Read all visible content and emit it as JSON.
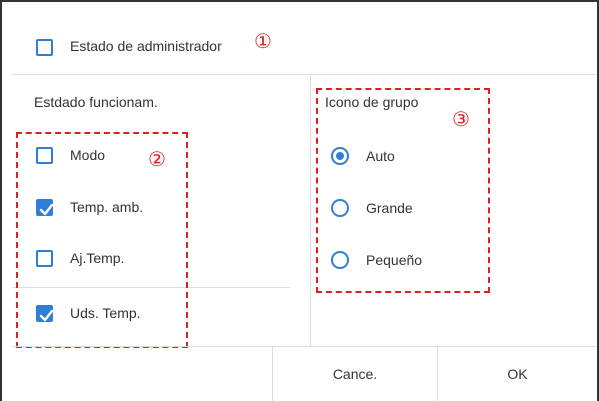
{
  "admin": {
    "label": "Estado de administrador",
    "checked": false
  },
  "status_section": {
    "title": "Estdado funcionam.",
    "items": [
      {
        "label": "Modo",
        "checked": false
      },
      {
        "label": "Temp. amb.",
        "checked": true
      },
      {
        "label": "Aj.Temp.",
        "checked": false
      },
      {
        "label": "Uds. Temp.",
        "checked": true
      }
    ]
  },
  "group_icon": {
    "title": "Icono de grupo",
    "options": [
      {
        "label": "Auto",
        "selected": true
      },
      {
        "label": "Grande",
        "selected": false
      },
      {
        "label": "Pequeño",
        "selected": false
      }
    ]
  },
  "footer": {
    "cancel_label": "Cance.",
    "ok_label": "OK"
  },
  "annotations": {
    "one": "①",
    "two": "②",
    "three": "③"
  },
  "colors": {
    "accent": "#2f7fd8",
    "annotation": "#e02020"
  }
}
